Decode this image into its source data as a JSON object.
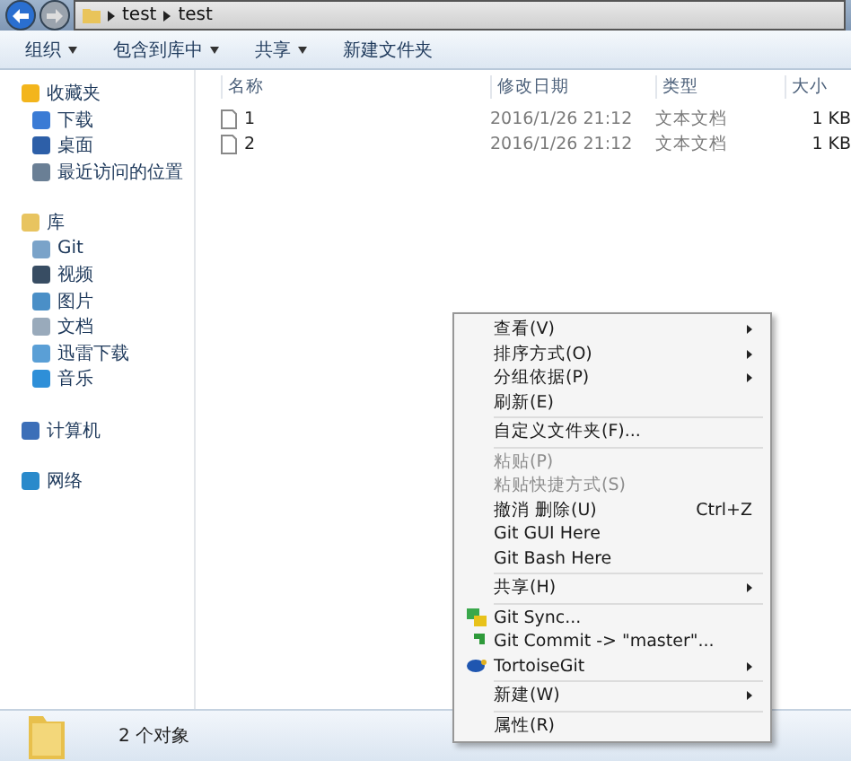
{
  "address_bar": {
    "path": [
      "test",
      "test"
    ]
  },
  "toolbar": [
    "组织",
    "包含到库中",
    "共享",
    "新建文件夹"
  ],
  "sidebar": [
    {
      "label": "收藏夹",
      "children": [
        "下载",
        "桌面",
        "最近访问的位置"
      ]
    },
    {
      "label": "库",
      "children": [
        "Git",
        "视频",
        "图片",
        "文档",
        "迅雷下载",
        "音乐"
      ]
    },
    {
      "label": "计算机"
    },
    {
      "label": "网络"
    }
  ],
  "table": {
    "columns": [
      "名称",
      "修改日期",
      "类型",
      "大小"
    ],
    "rows": [
      [
        "1",
        "2016/1/26 21:12",
        "文本文档",
        "1 KB"
      ],
      [
        "2",
        "2016/1/26 21:12",
        "文本文档",
        "1 KB"
      ]
    ]
  },
  "context_menu": [
    {
      "kind": "item",
      "label": "查看(V)",
      "submenu": true
    },
    {
      "kind": "item",
      "label": "排序方式(O)",
      "submenu": true
    },
    {
      "kind": "item",
      "label": "分组依据(P)",
      "submenu": true
    },
    {
      "kind": "item",
      "label": "刷新(E)"
    },
    {
      "kind": "separator"
    },
    {
      "kind": "item",
      "label": "自定义文件夹(F)..."
    },
    {
      "kind": "separator"
    },
    {
      "kind": "item",
      "label": "粘贴(P)",
      "disabled": true
    },
    {
      "kind": "item",
      "label": "粘贴快捷方式(S)",
      "disabled": true
    },
    {
      "kind": "item",
      "label": "撤消 删除(U)",
      "shortcut": "Ctrl+Z"
    },
    {
      "kind": "item",
      "label": "Git GUI Here"
    },
    {
      "kind": "item",
      "label": "Git Bash Here"
    },
    {
      "kind": "separator"
    },
    {
      "kind": "item",
      "label": "共享(H)",
      "submenu": true
    },
    {
      "kind": "separator"
    },
    {
      "kind": "icon_item",
      "label": "Git Sync..."
    },
    {
      "kind": "icon_item",
      "label": "Git Commit -> \"master\"..."
    },
    {
      "kind": "icon_item",
      "label": "TortoiseGit",
      "submenu": true
    },
    {
      "kind": "separator"
    },
    {
      "kind": "item",
      "label": "新建(W)",
      "submenu": true
    },
    {
      "kind": "separator"
    },
    {
      "kind": "item",
      "label": "属性(R)"
    }
  ],
  "status_bar": {
    "text": "2 个对象"
  }
}
